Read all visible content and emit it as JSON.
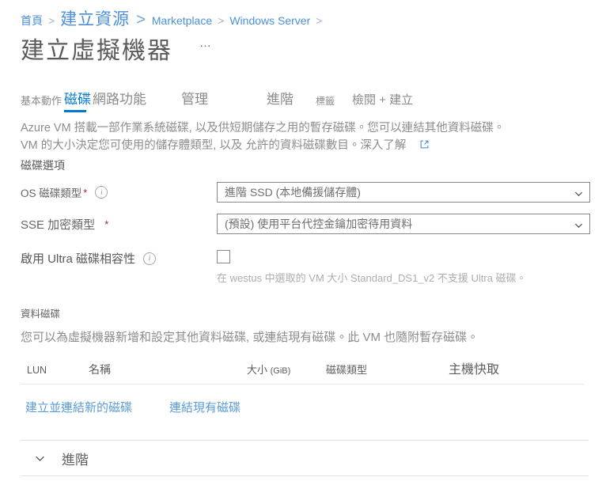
{
  "breadcrumb": {
    "items": [
      {
        "label": "首頁",
        "style": "small"
      },
      {
        "label": "建立資源",
        "style": "strong"
      },
      {
        "label": "Marketplace",
        "style": "small"
      },
      {
        "label": "Windows Server",
        "style": "small"
      }
    ],
    "separator": ">"
  },
  "header": {
    "title": "建立虛擬機器",
    "more_menu": "…"
  },
  "tabs": [
    {
      "label": "基本動作",
      "active": false
    },
    {
      "label": "磁碟",
      "active": true
    },
    {
      "label": "網路功能",
      "active": false
    },
    {
      "label": "管理",
      "active": false
    },
    {
      "label": "進階",
      "active": false
    },
    {
      "label": "標籤",
      "active": false
    },
    {
      "label": "檢閱 + 建立",
      "active": false
    }
  ],
  "description": {
    "line1": "Azure VM 搭載一部作業系統磁碟, 以及供短期儲存之用的暫存磁碟。您可以連結其他資料磁碟。",
    "line2": "VM 的大小決定您可使用的儲存體類型, 以及 允許的資料磁碟數目。",
    "learn_more": "深入了解"
  },
  "disk_options": {
    "section_title": "磁碟選項",
    "os_disk_type": {
      "label": "OS 磁碟類型",
      "required_mark": "*",
      "value": "進階 SSD (本地備援儲存體)"
    },
    "sse_encryption": {
      "label": "SSE 加密類型",
      "required_mark": "*",
      "value": "(預設) 使用平台代控金鑰加密待用資料"
    },
    "ultra_disk": {
      "label": "啟用 Ultra 磁碟相容性",
      "checked": false,
      "hint": "在 westus 中選取的 VM 大小 Standard_DS1_v2 不支援 Ultra 磁碟。"
    }
  },
  "data_disks": {
    "section_title": "資料磁碟",
    "paragraph": "您可以為虛擬機器新增和設定其他資料磁碟, 或連結現有磁碟。此 VM 也隨附暫存磁碟。",
    "columns": [
      "LUN",
      "名稱",
      "大小 (GiB)",
      "磁碟類型",
      "主機快取"
    ],
    "size_unit": "(GiB)",
    "size_label": "大小",
    "rows": [],
    "actions": {
      "create_attach": "建立並連結新的磁碟",
      "attach_existing": "連結現有磁碟"
    }
  },
  "advanced": {
    "title": "進階",
    "expanded": false
  },
  "colors": {
    "accent": "#0078d4",
    "link": "#5b9bd5",
    "required": "#a4262c",
    "text": "#5a5a5a",
    "muted": "#8c8c8c"
  }
}
